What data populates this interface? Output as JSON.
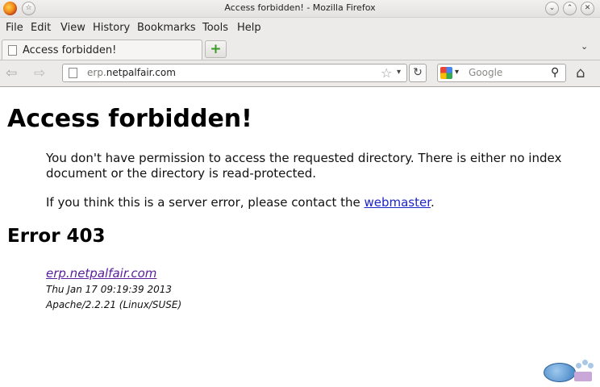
{
  "window": {
    "title": "Access forbidden! - Mozilla Firefox",
    "pin_glyph": "☆",
    "minimize_glyph": "⌄",
    "maximize_glyph": "⌃",
    "close_glyph": "✕"
  },
  "menu": {
    "file": "File",
    "edit": "Edit",
    "view": "View",
    "history": "History",
    "bookmarks": "Bookmarks",
    "tools": "Tools",
    "help": "Help"
  },
  "tabs": [
    {
      "label": "Access forbidden!",
      "icon": "page-icon",
      "active": true
    }
  ],
  "tabbar": {
    "new_tab_glyph": "+",
    "list_all_glyph": "⌄"
  },
  "navbar": {
    "back_glyph": "⇦",
    "forward_glyph": "⇨",
    "url_scheme_part": "erp.",
    "url_domain_part": "netpalfair.com",
    "bookmark_star_glyph": "☆",
    "url_dropdown_glyph": "▾",
    "reload_glyph": "↻",
    "search_engine_arrow": "▾",
    "search_placeholder": "Google",
    "search_go_glyph": "⚲",
    "home_glyph": "⌂"
  },
  "page": {
    "heading": "Access forbidden!",
    "paragraph1": "You don't have permission to access the requested directory. There is either no index document or the directory is read-protected.",
    "paragraph2_prefix": "If you think this is a server error, please contact the ",
    "paragraph2_link": "webmaster",
    "paragraph2_suffix": ".",
    "error_heading": "Error 403",
    "address_link": "erp.netpalfair.com",
    "address_date": "Thu Jan 17 09:19:39 2013",
    "address_server": "Apache/2.2.21 (Linux/SUSE)"
  },
  "colors": {
    "link": "#1a24c8",
    "visited_link": "#5a1e9c",
    "chrome_background": "#ecebe9"
  }
}
